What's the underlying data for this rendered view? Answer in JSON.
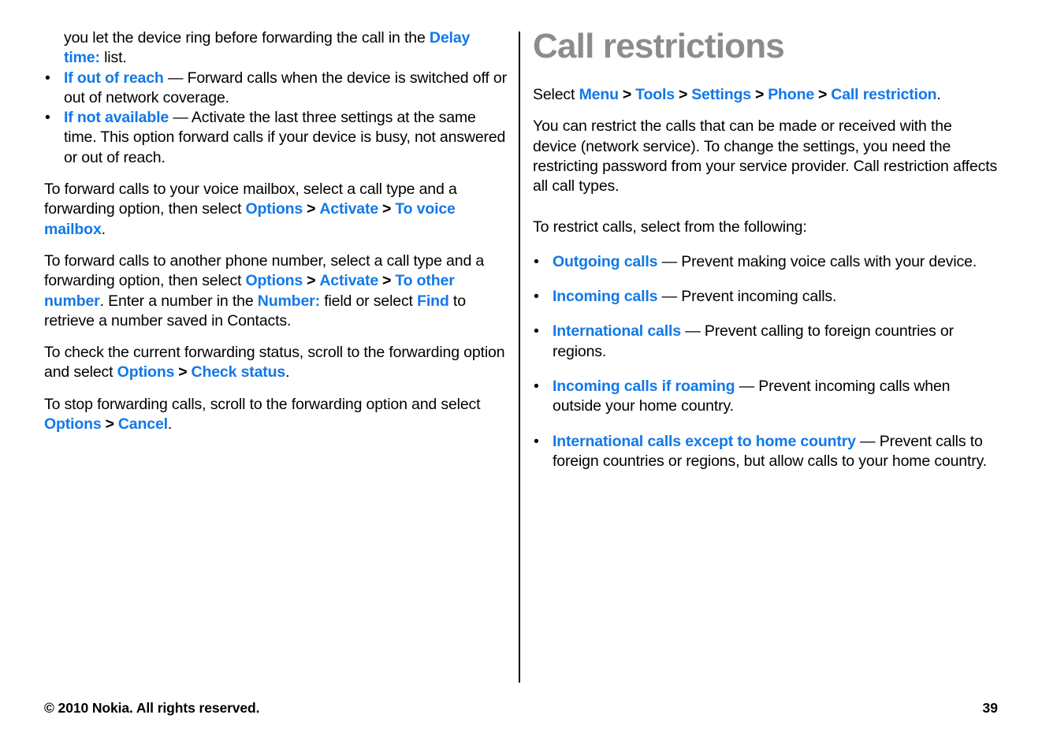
{
  "colors": {
    "link": "#1278e8",
    "heading": "#8c8c8c",
    "text": "#000000",
    "divider": "#000000",
    "background": "#ffffff"
  },
  "left_column": {
    "continuation_paragraph": {
      "text_1": "you let the device ring before forwarding the call in the ",
      "link_1": "Delay time:",
      "text_2": " list."
    },
    "bullets": [
      {
        "term": "If out of reach",
        "dash": " — ",
        "description": "Forward calls when the device is switched off or out of network coverage."
      },
      {
        "term": "If not available",
        "dash": " — ",
        "description": "Activate the last three settings at the same time. This option forward calls if your device is busy, not answered or out of reach."
      }
    ],
    "paragraphs": [
      {
        "id": "voice-mailbox",
        "parts": [
          {
            "type": "text",
            "value": "To forward calls to your voice mailbox, select a call type and a forwarding option, then select "
          },
          {
            "type": "link",
            "value": "Options"
          },
          {
            "type": "sep",
            "value": ">"
          },
          {
            "type": "link",
            "value": "Activate"
          },
          {
            "type": "sep",
            "value": ">"
          },
          {
            "type": "link",
            "value": "To voice mailbox"
          },
          {
            "type": "text",
            "value": "."
          }
        ]
      },
      {
        "id": "other-number",
        "parts": [
          {
            "type": "text",
            "value": "To forward calls to another phone number, select a call type and a forwarding option, then select "
          },
          {
            "type": "link",
            "value": "Options"
          },
          {
            "type": "sep",
            "value": ">"
          },
          {
            "type": "link",
            "value": "Activate"
          },
          {
            "type": "sep",
            "value": ">"
          },
          {
            "type": "link",
            "value": "To other number"
          },
          {
            "type": "text",
            "value": ". Enter a number in the "
          },
          {
            "type": "link",
            "value": "Number:"
          },
          {
            "type": "text",
            "value": " field or select "
          },
          {
            "type": "link",
            "value": "Find"
          },
          {
            "type": "text",
            "value": " to retrieve a number saved in Contacts."
          }
        ]
      },
      {
        "id": "check-status",
        "parts": [
          {
            "type": "text",
            "value": "To check the current forwarding status, scroll to the forwarding option and select "
          },
          {
            "type": "link",
            "value": "Options"
          },
          {
            "type": "sep",
            "value": ">"
          },
          {
            "type": "link",
            "value": "Check status"
          },
          {
            "type": "text",
            "value": "."
          }
        ]
      },
      {
        "id": "stop-forwarding",
        "parts": [
          {
            "type": "text",
            "value": "To stop forwarding calls, scroll to the forwarding option and select "
          },
          {
            "type": "link",
            "value": "Options"
          },
          {
            "type": "sep",
            "value": ">"
          },
          {
            "type": "link",
            "value": "Cancel"
          },
          {
            "type": "text",
            "value": "."
          }
        ]
      }
    ]
  },
  "right_column": {
    "heading": "Call restrictions",
    "breadcrumb": {
      "prefix": "Select ",
      "items": [
        "Menu",
        "Tools",
        "Settings",
        "Phone",
        "Call restriction"
      ],
      "separator": ">",
      "suffix": "."
    },
    "intro_paragraph": "You can restrict the calls that can be made or received with the device (network service). To change the settings, you need the restricting password from your service provider. Call restriction affects all call types.",
    "list_intro": "To restrict calls, select from the following:",
    "bullets": [
      {
        "term": "Outgoing calls",
        "dash": " — ",
        "description": "Prevent making voice calls with your device."
      },
      {
        "term": "Incoming calls",
        "dash": " — ",
        "description": "Prevent incoming calls."
      },
      {
        "term": "International calls",
        "dash": " — ",
        "description": "Prevent calling to foreign countries or regions."
      },
      {
        "term": "Incoming calls if roaming",
        "dash": " — ",
        "description": "Prevent incoming calls when outside your home country."
      },
      {
        "term": "International calls except to home country",
        "dash": " — ",
        "description": "Prevent calls to foreign countries or regions, but allow calls to your home country."
      }
    ]
  },
  "footer": {
    "copyright": "© 2010 Nokia. All rights reserved.",
    "page_number": "39"
  },
  "icons": {
    "bullet": "•"
  }
}
